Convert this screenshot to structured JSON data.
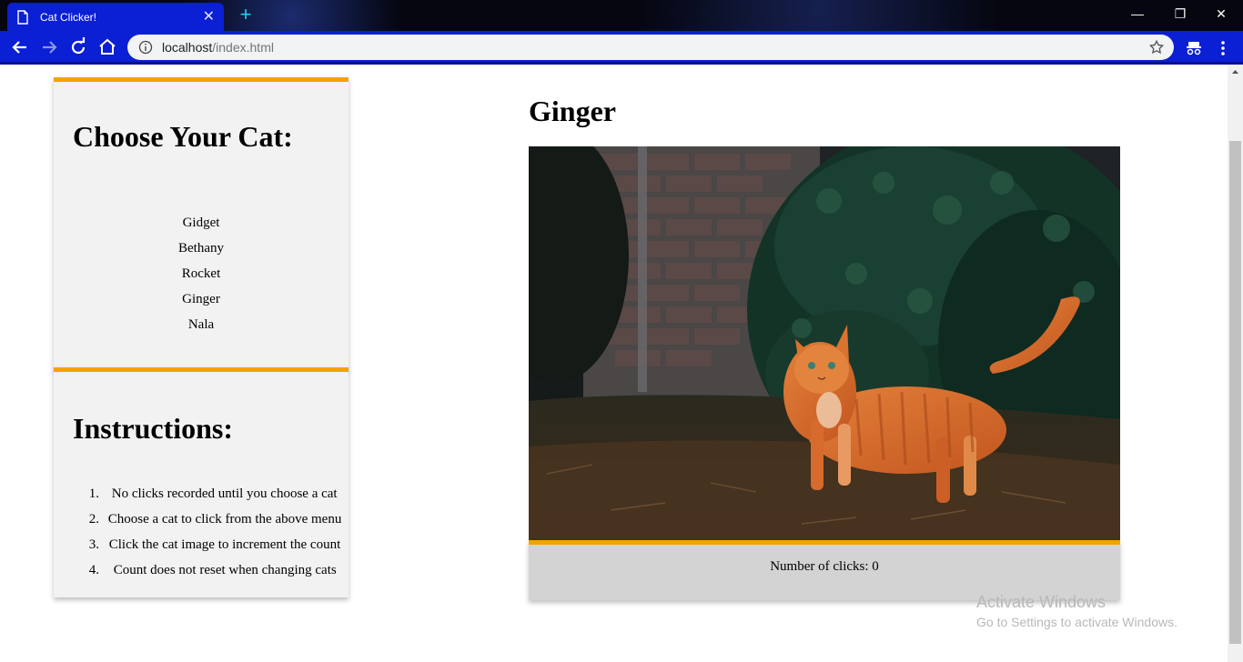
{
  "browser": {
    "tab_title": "Cat Clicker!",
    "url_host": "localhost",
    "url_path": "/index.html"
  },
  "sidebar": {
    "choose_heading": "Choose Your Cat:",
    "cats": [
      "Gidget",
      "Bethany",
      "Rocket",
      "Ginger",
      "Nala"
    ],
    "instructions_heading": "Instructions:",
    "instructions": [
      {
        "num": "1.",
        "text": "No clicks recorded until you choose a cat"
      },
      {
        "num": "2.",
        "text": "Choose a cat to click from the above menu"
      },
      {
        "num": "3.",
        "text": "Click the cat image to increment the count"
      },
      {
        "num": "4.",
        "text": "Count does not reset when changing cats"
      }
    ]
  },
  "main": {
    "cat_name": "Ginger",
    "clicks_text": "Number of clicks: 0"
  },
  "watermark": {
    "line1": "Activate Windows",
    "line2": "Go to Settings to activate Windows."
  },
  "colors": {
    "accent": "#f5a200",
    "chrome_blue": "#0b1fd4",
    "card_bg": "#f2f2f2",
    "counter_bg": "#d3d3d3"
  }
}
